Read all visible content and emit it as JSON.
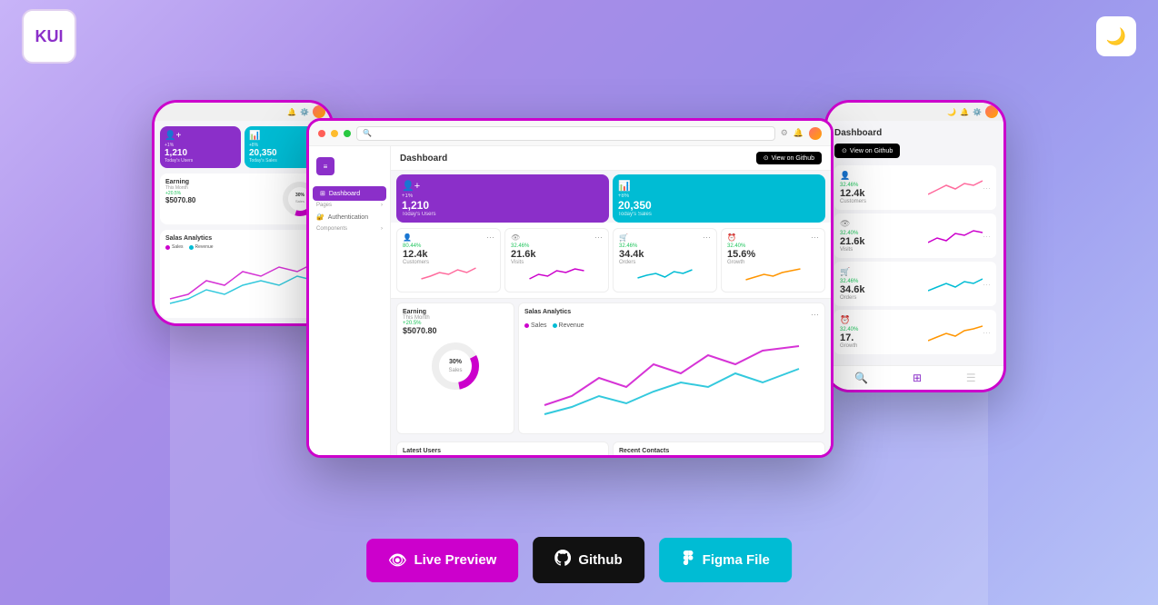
{
  "header": {
    "logo_text": "KUI",
    "dark_mode_icon": "🌙"
  },
  "buttons": {
    "live_preview": "Live Preview",
    "github": "Github",
    "figma_file": "Figma File"
  },
  "dashboard": {
    "title": "Dashboard",
    "view_github": "View on Github",
    "stats": [
      {
        "icon": "👤",
        "pct": "80.44%",
        "value": "12.4k",
        "label": "Customers",
        "color": "#ff6b9d"
      },
      {
        "icon": "👁",
        "pct": "32.46%",
        "value": "21.6k",
        "label": "Visits",
        "color": "#cc00cc"
      },
      {
        "icon": "🛒",
        "pct": "32.46%",
        "value": "34.4k",
        "label": "Orders",
        "color": "#00bcd4"
      },
      {
        "icon": "⏰",
        "pct": "32.40%",
        "value": "15.6%",
        "label": "Growth",
        "color": "#ff9500"
      }
    ],
    "earning": {
      "title": "Earning",
      "subtitle": "This Month",
      "pct": "+20.5%",
      "amount": "$5070.80",
      "donut_pct": "30%",
      "donut_label": "Sales"
    },
    "analytics": {
      "title": "Salas Analytics",
      "legend": [
        "Sales",
        "Revenue"
      ]
    },
    "user_cards": [
      {
        "type": "purple",
        "pct": "+1%",
        "value": "1,210",
        "label": "Today's Users"
      },
      {
        "type": "cyan",
        "pct": "+8%",
        "value": "20,350",
        "label": "Today's Sales"
      }
    ],
    "sidebar": {
      "items": [
        "Dashboard",
        "Pages",
        "Authentication",
        "Components"
      ]
    }
  },
  "left_phone": {
    "user_cards": [
      {
        "type": "purple",
        "pct": "+1%",
        "value": "1,210",
        "label": "Today's Users"
      },
      {
        "type": "cyan",
        "pct": "+8%",
        "value": "20,350",
        "label": "Today's Sales"
      }
    ],
    "earning": {
      "title": "Earning",
      "subtitle": "This Month",
      "pct": "+20.5%",
      "amount": "$5070.80",
      "donut_pct": "30%",
      "donut_label": "Sales"
    },
    "analytics_title": "Salas Analytics"
  },
  "right_phone": {
    "title": "Dashboard",
    "view_github": "View on Github",
    "stats": [
      {
        "icon": "👤",
        "pct": "32.46%",
        "value": "12.4k",
        "label": "Customers"
      },
      {
        "icon": "👁",
        "pct": "32.40%",
        "value": "21.6k",
        "label": "Visits"
      },
      {
        "icon": "🛒",
        "pct": "32.46%",
        "value": "34.6k",
        "label": "Orders"
      },
      {
        "icon": "⏰",
        "pct": "32.40%",
        "value": "17.",
        "label": "Growth"
      }
    ]
  }
}
